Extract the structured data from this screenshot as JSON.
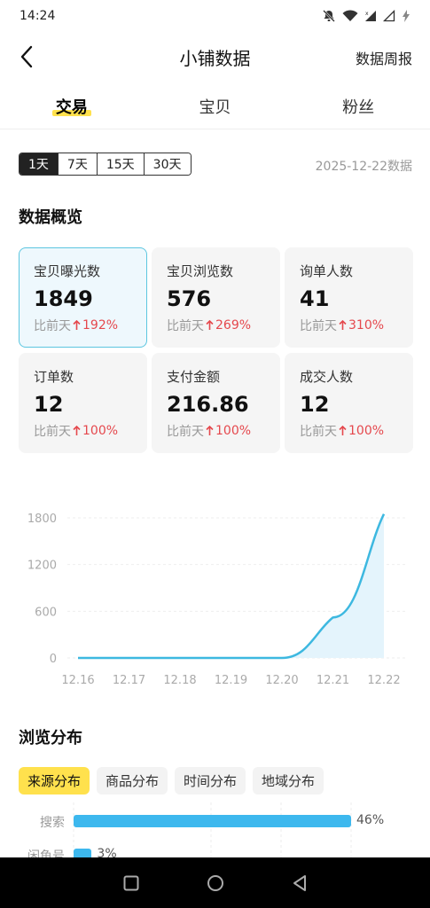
{
  "status": {
    "time": "14:24"
  },
  "header": {
    "title": "小铺数据",
    "action": "数据周报"
  },
  "tabs": [
    {
      "label": "交易",
      "active": true
    },
    {
      "label": "宝贝",
      "active": false
    },
    {
      "label": "粉丝",
      "active": false
    }
  ],
  "range": {
    "options": [
      "1天",
      "7天",
      "15天",
      "30天"
    ],
    "selected": "1天",
    "date_label": "2025-12-22数据"
  },
  "overview": {
    "title": "数据概览",
    "compare_prefix": "比前天",
    "cards": [
      {
        "label": "宝贝曝光数",
        "value": "1849",
        "change": "192%",
        "selected": true
      },
      {
        "label": "宝贝浏览数",
        "value": "576",
        "change": "269%",
        "selected": false
      },
      {
        "label": "询单人数",
        "value": "41",
        "change": "310%",
        "selected": false
      },
      {
        "label": "订单数",
        "value": "12",
        "change": "100%",
        "selected": false
      },
      {
        "label": "支付金额",
        "value": "216.86",
        "change": "100%",
        "selected": false
      },
      {
        "label": "成交人数",
        "value": "12",
        "change": "100%",
        "selected": false
      }
    ]
  },
  "chart_data": {
    "type": "area",
    "categories": [
      "12.16",
      "12.17",
      "12.18",
      "12.19",
      "12.20",
      "12.21",
      "12.22"
    ],
    "values": [
      0,
      0,
      0,
      0,
      0,
      520,
      1849
    ],
    "yticks": [
      0,
      600,
      1200,
      1800
    ],
    "ylim": [
      0,
      1800
    ],
    "grid": true,
    "line_color": "#3db8e0",
    "fill_color": "#e4f4fc"
  },
  "distribution": {
    "title": "浏览分布",
    "tabs": [
      {
        "label": "来源分布",
        "active": true
      },
      {
        "label": "商品分布",
        "active": false
      },
      {
        "label": "时间分布",
        "active": false
      },
      {
        "label": "地域分布",
        "active": false
      }
    ],
    "rows": [
      {
        "label": "搜索",
        "percent": 46,
        "value_label": "46%"
      },
      {
        "label": "闲鱼号",
        "percent": 3,
        "value_label": "3%"
      }
    ]
  },
  "colors": {
    "accent": "#ffe14d",
    "up": "#e5484d",
    "selected_border": "#5cc6e0"
  }
}
